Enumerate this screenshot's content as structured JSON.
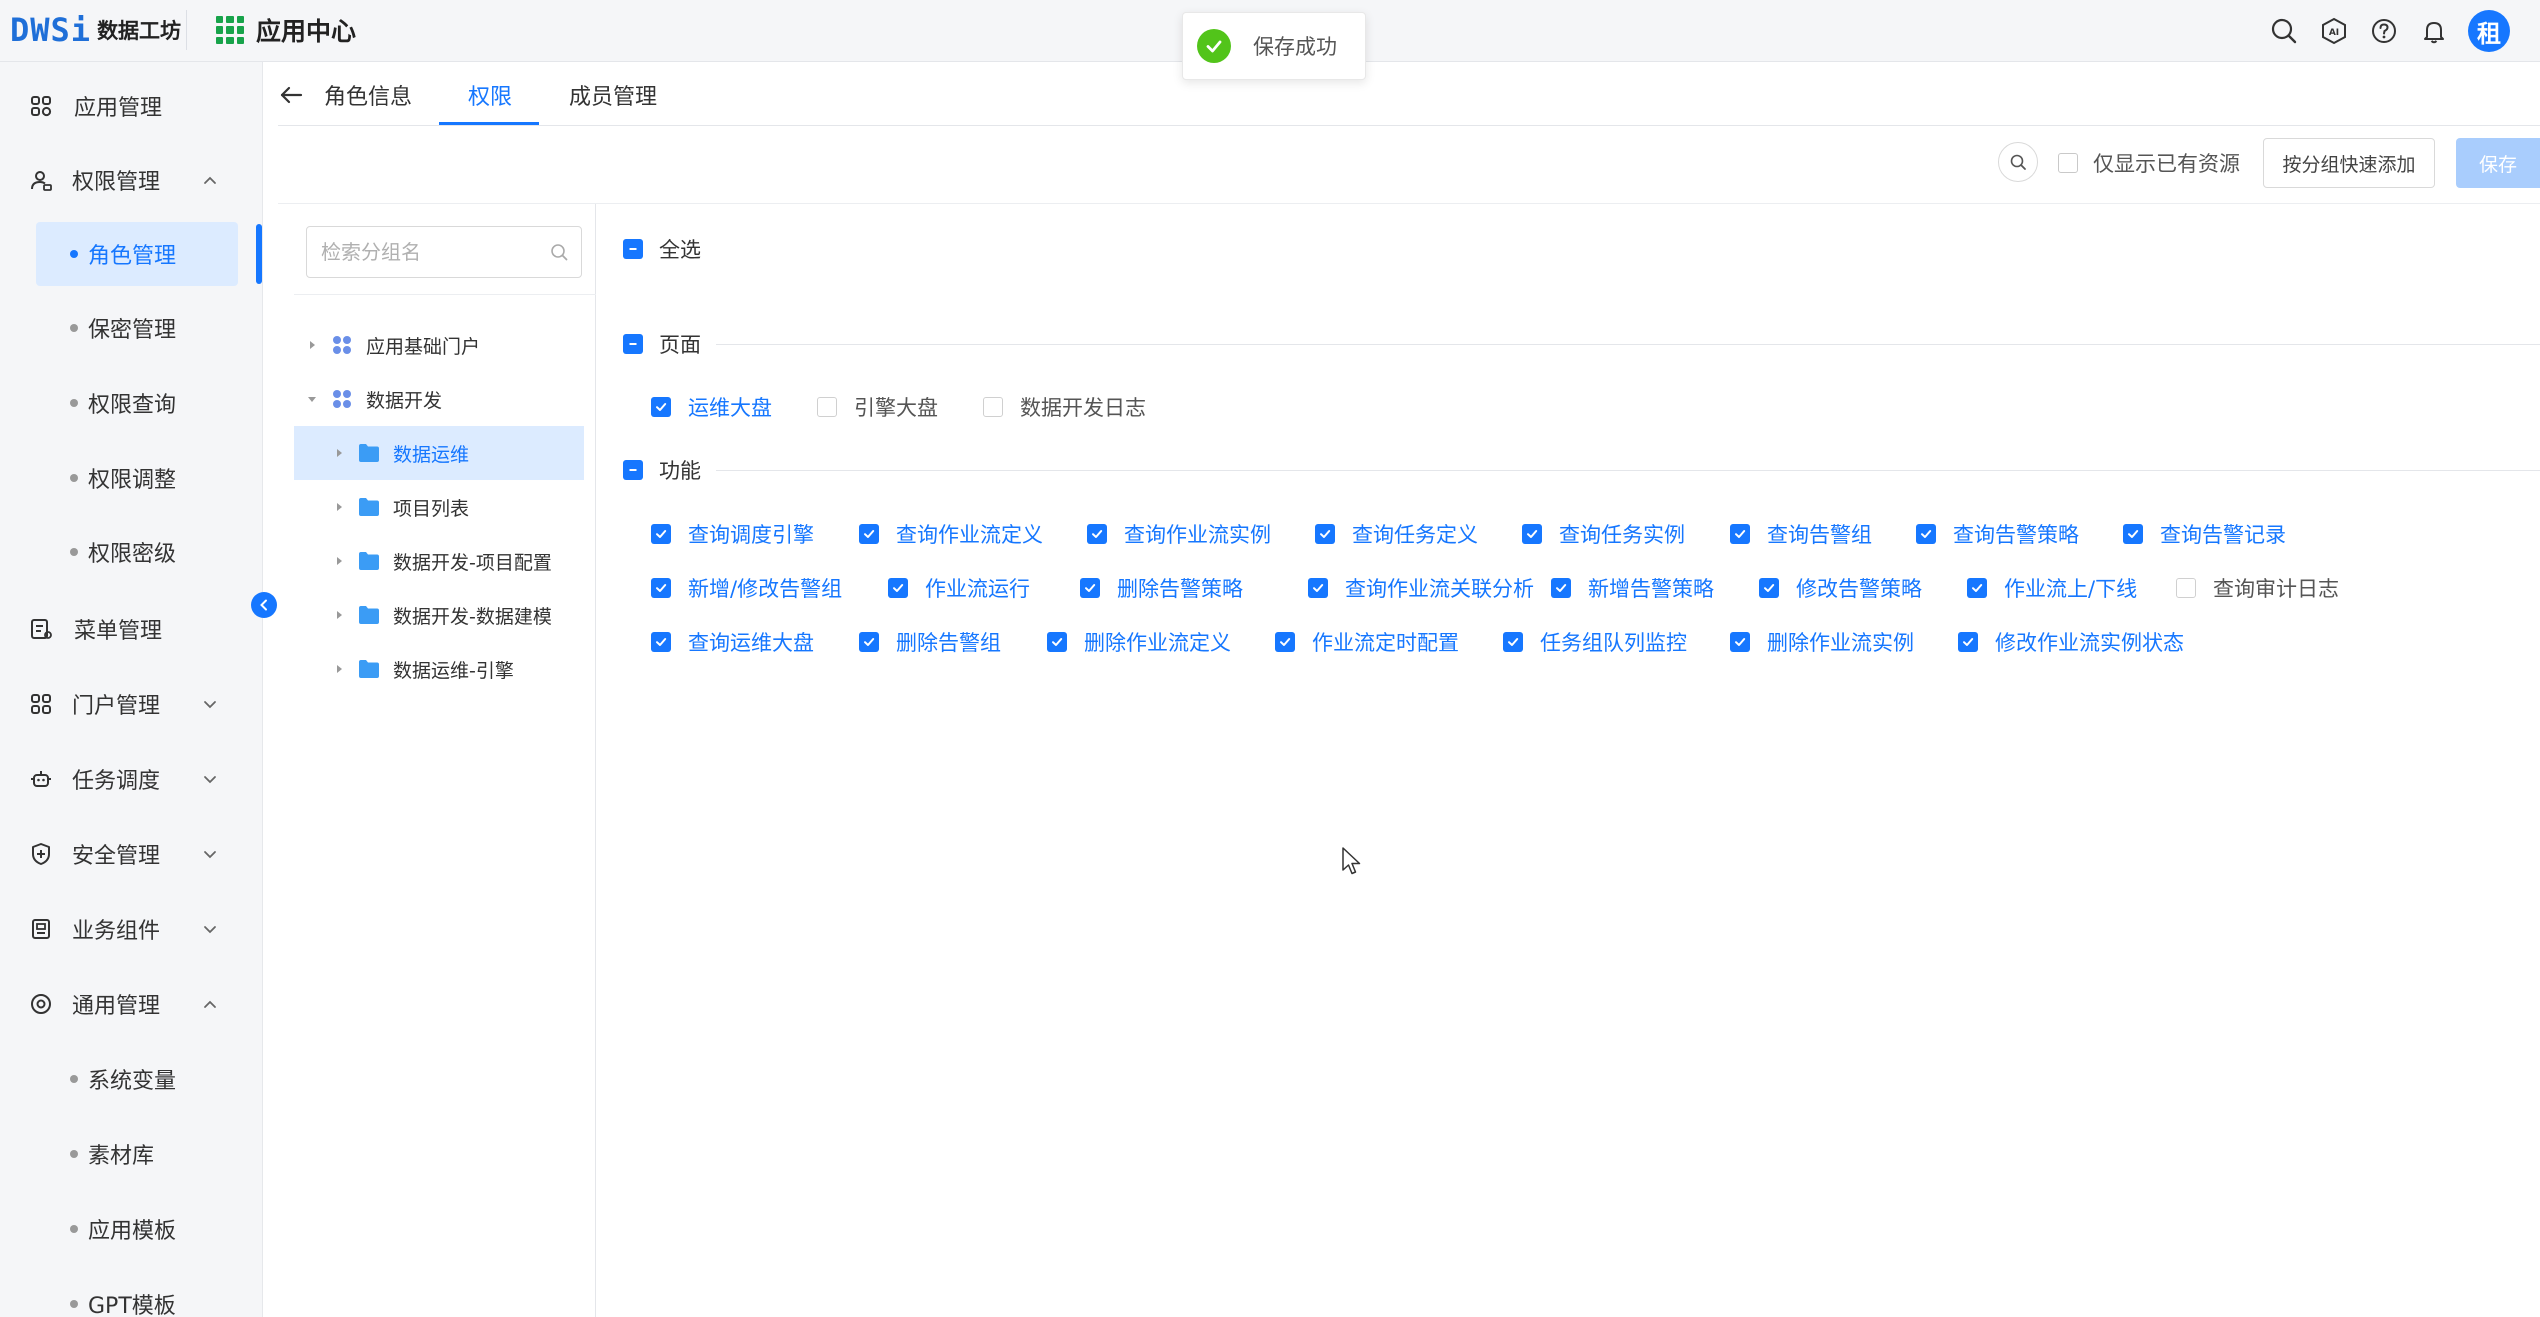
{
  "header": {
    "logo_text": "DWSi",
    "logo_subtitle": "数据工坊",
    "app_center_label": "应用中心",
    "avatar_text": "租",
    "colors": {
      "accent": "#1677ff",
      "success": "#52c41a",
      "app_icon": "#17a34a"
    },
    "icons": [
      "search-icon",
      "ai-icon",
      "help-icon",
      "bell-icon"
    ]
  },
  "toast": {
    "message": "保存成功",
    "icon": "check-circle-icon"
  },
  "sidebar": {
    "items": [
      {
        "label": "应用管理",
        "icon": "apps-icon"
      },
      {
        "label": "权限管理",
        "icon": "user-lock-icon",
        "expanded": true,
        "children": [
          {
            "label": "角色管理",
            "active": true
          },
          {
            "label": "保密管理"
          },
          {
            "label": "权限查询"
          },
          {
            "label": "权限调整"
          },
          {
            "label": "权限密级"
          }
        ]
      },
      {
        "label": "菜单管理",
        "icon": "menu-icon"
      },
      {
        "label": "门户管理",
        "icon": "portal-icon",
        "expanded": false
      },
      {
        "label": "任务调度",
        "icon": "robot-icon",
        "expanded": false
      },
      {
        "label": "安全管理",
        "icon": "shield-icon",
        "expanded": false
      },
      {
        "label": "业务组件",
        "icon": "component-icon",
        "expanded": false
      },
      {
        "label": "通用管理",
        "icon": "target-icon",
        "expanded": true,
        "children": [
          {
            "label": "系统变量"
          },
          {
            "label": "素材库"
          },
          {
            "label": "应用模板"
          },
          {
            "label": "GPT模板"
          }
        ]
      }
    ]
  },
  "tabs": [
    {
      "label": "角色信息"
    },
    {
      "label": "权限",
      "active": true
    },
    {
      "label": "成员管理"
    }
  ],
  "toolbar": {
    "only_existing_label": "仅显示已有资源",
    "only_existing_checked": false,
    "group_add_label": "按分组快速添加",
    "save_label": "保存"
  },
  "tree": {
    "search_placeholder": "检索分组名",
    "nodes": [
      {
        "label": "应用基础门户",
        "type": "group",
        "expanded": false
      },
      {
        "label": "数据开发",
        "type": "group",
        "expanded": true,
        "children": [
          {
            "label": "数据运维",
            "type": "folder",
            "selected": true
          },
          {
            "label": "项目列表",
            "type": "folder"
          },
          {
            "label": "数据开发-项目配置",
            "type": "folder"
          },
          {
            "label": "数据开发-数据建模",
            "type": "folder"
          },
          {
            "label": "数据运维-引擎",
            "type": "folder"
          }
        ]
      }
    ]
  },
  "permissions": {
    "select_all_label": "全选",
    "pages": {
      "label": "页面",
      "items": [
        {
          "label": "运维大盘",
          "checked": true
        },
        {
          "label": "引擎大盘",
          "checked": false
        },
        {
          "label": "数据开发日志",
          "checked": false
        }
      ]
    },
    "functions": {
      "label": "功能",
      "rows": [
        [
          {
            "label": "查询调度引擎",
            "checked": true
          },
          {
            "label": "查询作业流定义",
            "checked": true
          },
          {
            "label": "查询作业流实例",
            "checked": true
          },
          {
            "label": "查询任务定义",
            "checked": true
          },
          {
            "label": "查询任务实例",
            "checked": true
          },
          {
            "label": "查询告警组",
            "checked": true
          },
          {
            "label": "查询告警策略",
            "checked": true
          },
          {
            "label": "查询告警记录",
            "checked": true
          }
        ],
        [
          {
            "label": "新增/修改告警组",
            "checked": true
          },
          {
            "label": "作业流运行",
            "checked": true
          },
          {
            "label": "删除告警策略",
            "checked": true
          },
          {
            "label": "查询作业流关联分析",
            "checked": true
          },
          {
            "label": "新增告警策略",
            "checked": true
          },
          {
            "label": "修改告警策略",
            "checked": true
          },
          {
            "label": "作业流上/下线",
            "checked": true
          },
          {
            "label": "查询审计日志",
            "checked": false
          }
        ],
        [
          {
            "label": "查询运维大盘",
            "checked": true
          },
          {
            "label": "删除告警组",
            "checked": true
          },
          {
            "label": "删除作业流定义",
            "checked": true
          },
          {
            "label": "作业流定时配置",
            "checked": true
          },
          {
            "label": "任务组队列监控",
            "checked": true
          },
          {
            "label": "删除作业流实例",
            "checked": true
          },
          {
            "label": "修改作业流实例状态",
            "checked": true
          }
        ]
      ]
    }
  }
}
